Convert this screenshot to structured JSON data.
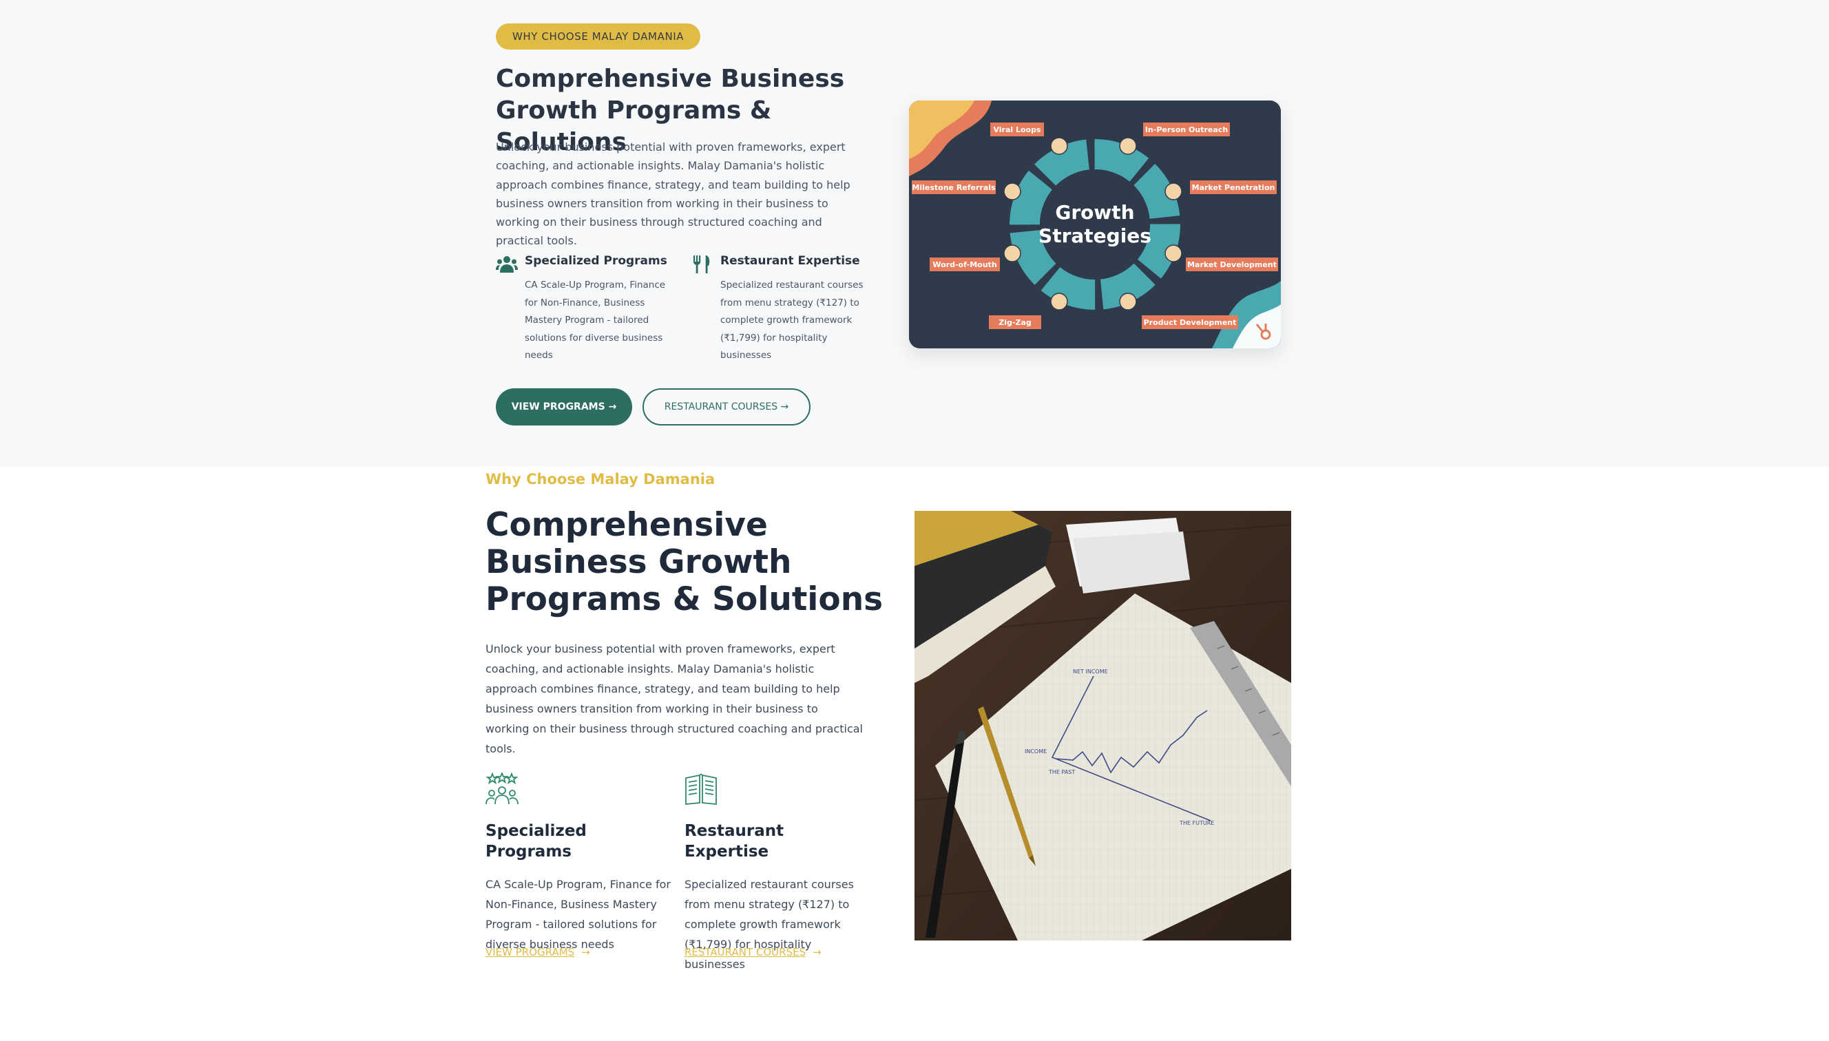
{
  "top": {
    "badge": "WHY CHOOSE MALAY DAMANIA",
    "title": "Comprehensive Business Growth Programs & Solutions",
    "paragraph": "Unlock your business potential with proven frameworks, expert coaching, and actionable insights. Malay Damania's holistic approach combines finance, strategy, and team building to help business owners transition from working in their business to working on their business through structured coaching and practical tools.",
    "features": [
      {
        "icon": "people-icon",
        "title": "Specialized Programs",
        "text": "CA Scale-Up Program, Finance for Non-Finance, Business Mastery Program - tailored solutions for diverse business needs"
      },
      {
        "icon": "utensils-icon",
        "title": "Restaurant Expertise",
        "text": "Specialized restaurant courses from menu strategy (₹127) to complete growth framework (₹1,799) for hospitality businesses"
      }
    ],
    "btn_primary": "VIEW PROGRAMS →",
    "btn_secondary": "RESTAURANT COURSES →",
    "graphic": {
      "center_line1": "Growth",
      "center_line2": "Strategies",
      "labels": [
        "Viral Loops",
        "In-Person Outreach",
        "Milestone Referrals",
        "Market Penetration",
        "Word-of-Mouth",
        "Market Development",
        "Zig-Zag",
        "Product Development"
      ]
    }
  },
  "bottom": {
    "eyebrow": "Why Choose Malay Damania",
    "title": "Comprehensive Business Growth Programs & Solutions",
    "paragraph": "Unlock your business potential with proven frameworks, expert coaching, and actionable insights. Malay Damania's holistic approach combines finance, strategy, and team building to help business owners transition from working in their business to working on their business through structured coaching and practical tools.",
    "features": [
      {
        "icon": "team-stars-icon",
        "title": "Specialized Programs",
        "text": "CA Scale-Up Program, Finance for Non-Finance, Business Mastery Program - tailored solutions for diverse business needs",
        "link": "VIEW PROGRAMS"
      },
      {
        "icon": "open-book-icon",
        "title": "Restaurant Expertise",
        "text": "Specialized restaurant courses from menu strategy (₹127) to complete growth framework (₹1,799) for hospitality businesses",
        "link": "RESTAURANT COURSES"
      }
    ],
    "link_arrow": "→",
    "photo": {
      "chart_labels": {
        "top": "NET INCOME",
        "left": "INCOME",
        "past": "THE PAST",
        "future": "THE FUTURE"
      }
    }
  },
  "colors": {
    "accent": "#e1bc45",
    "primary": "#2e6e62",
    "heading": "#1f2a3a",
    "card_bg": "#2f3a4a",
    "ring": "#4aa8b0",
    "tag": "#e57c5c"
  }
}
